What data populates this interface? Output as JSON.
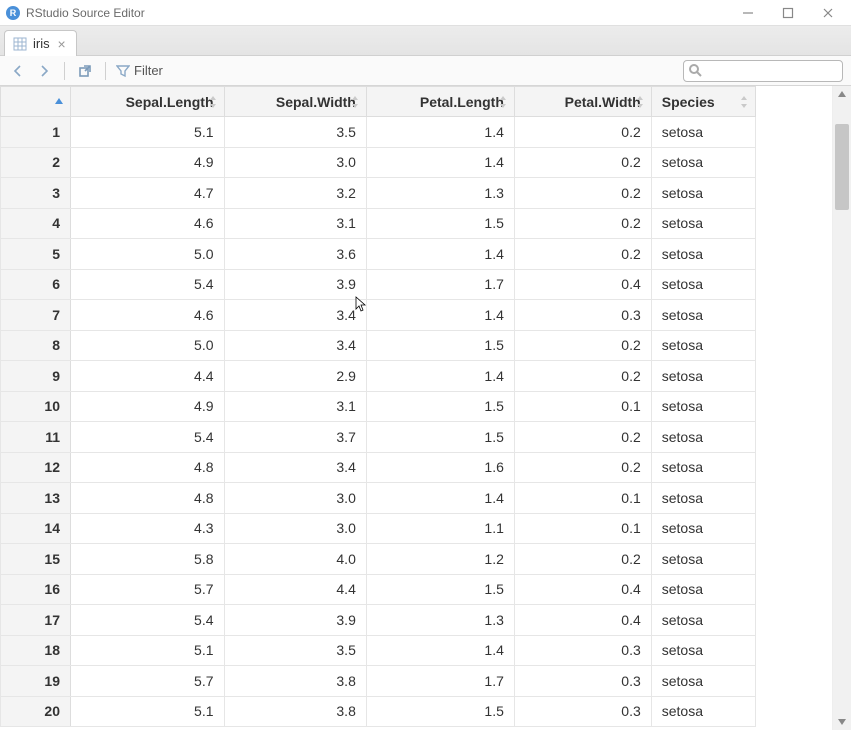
{
  "window": {
    "title": "RStudio Source Editor"
  },
  "tab": {
    "label": "iris"
  },
  "toolbar": {
    "filter_label": "Filter",
    "search_placeholder": ""
  },
  "columns": [
    {
      "name": "Sepal.Length",
      "type": "numeric"
    },
    {
      "name": "Sepal.Width",
      "type": "numeric"
    },
    {
      "name": "Petal.Length",
      "type": "numeric"
    },
    {
      "name": "Petal.Width",
      "type": "numeric"
    },
    {
      "name": "Species",
      "type": "text"
    }
  ],
  "rows": [
    {
      "idx": 1,
      "Sepal.Length": "5.1",
      "Sepal.Width": "3.5",
      "Petal.Length": "1.4",
      "Petal.Width": "0.2",
      "Species": "setosa"
    },
    {
      "idx": 2,
      "Sepal.Length": "4.9",
      "Sepal.Width": "3.0",
      "Petal.Length": "1.4",
      "Petal.Width": "0.2",
      "Species": "setosa"
    },
    {
      "idx": 3,
      "Sepal.Length": "4.7",
      "Sepal.Width": "3.2",
      "Petal.Length": "1.3",
      "Petal.Width": "0.2",
      "Species": "setosa"
    },
    {
      "idx": 4,
      "Sepal.Length": "4.6",
      "Sepal.Width": "3.1",
      "Petal.Length": "1.5",
      "Petal.Width": "0.2",
      "Species": "setosa"
    },
    {
      "idx": 5,
      "Sepal.Length": "5.0",
      "Sepal.Width": "3.6",
      "Petal.Length": "1.4",
      "Petal.Width": "0.2",
      "Species": "setosa"
    },
    {
      "idx": 6,
      "Sepal.Length": "5.4",
      "Sepal.Width": "3.9",
      "Petal.Length": "1.7",
      "Petal.Width": "0.4",
      "Species": "setosa"
    },
    {
      "idx": 7,
      "Sepal.Length": "4.6",
      "Sepal.Width": "3.4",
      "Petal.Length": "1.4",
      "Petal.Width": "0.3",
      "Species": "setosa"
    },
    {
      "idx": 8,
      "Sepal.Length": "5.0",
      "Sepal.Width": "3.4",
      "Petal.Length": "1.5",
      "Petal.Width": "0.2",
      "Species": "setosa"
    },
    {
      "idx": 9,
      "Sepal.Length": "4.4",
      "Sepal.Width": "2.9",
      "Petal.Length": "1.4",
      "Petal.Width": "0.2",
      "Species": "setosa"
    },
    {
      "idx": 10,
      "Sepal.Length": "4.9",
      "Sepal.Width": "3.1",
      "Petal.Length": "1.5",
      "Petal.Width": "0.1",
      "Species": "setosa"
    },
    {
      "idx": 11,
      "Sepal.Length": "5.4",
      "Sepal.Width": "3.7",
      "Petal.Length": "1.5",
      "Petal.Width": "0.2",
      "Species": "setosa"
    },
    {
      "idx": 12,
      "Sepal.Length": "4.8",
      "Sepal.Width": "3.4",
      "Petal.Length": "1.6",
      "Petal.Width": "0.2",
      "Species": "setosa"
    },
    {
      "idx": 13,
      "Sepal.Length": "4.8",
      "Sepal.Width": "3.0",
      "Petal.Length": "1.4",
      "Petal.Width": "0.1",
      "Species": "setosa"
    },
    {
      "idx": 14,
      "Sepal.Length": "4.3",
      "Sepal.Width": "3.0",
      "Petal.Length": "1.1",
      "Petal.Width": "0.1",
      "Species": "setosa"
    },
    {
      "idx": 15,
      "Sepal.Length": "5.8",
      "Sepal.Width": "4.0",
      "Petal.Length": "1.2",
      "Petal.Width": "0.2",
      "Species": "setosa"
    },
    {
      "idx": 16,
      "Sepal.Length": "5.7",
      "Sepal.Width": "4.4",
      "Petal.Length": "1.5",
      "Petal.Width": "0.4",
      "Species": "setosa"
    },
    {
      "idx": 17,
      "Sepal.Length": "5.4",
      "Sepal.Width": "3.9",
      "Petal.Length": "1.3",
      "Petal.Width": "0.4",
      "Species": "setosa"
    },
    {
      "idx": 18,
      "Sepal.Length": "5.1",
      "Sepal.Width": "3.5",
      "Petal.Length": "1.4",
      "Petal.Width": "0.3",
      "Species": "setosa"
    },
    {
      "idx": 19,
      "Sepal.Length": "5.7",
      "Sepal.Width": "3.8",
      "Petal.Length": "1.7",
      "Petal.Width": "0.3",
      "Species": "setosa"
    },
    {
      "idx": 20,
      "Sepal.Length": "5.1",
      "Sepal.Width": "3.8",
      "Petal.Length": "1.5",
      "Petal.Width": "0.3",
      "Species": "setosa"
    }
  ]
}
